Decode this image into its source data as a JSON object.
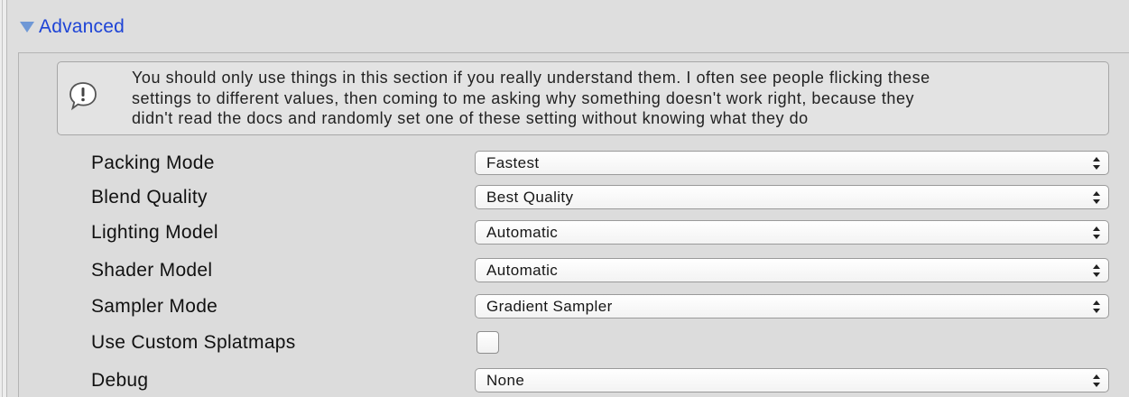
{
  "foldout": {
    "label": "Advanced",
    "expanded": true
  },
  "help_box": {
    "icon": "info-icon",
    "text": "You should only use things in this section if you really understand them. I often see people flicking these\nsettings to different values, then coming to me asking why something doesn't work right, because they\ndidn't read the docs and randomly set one of these setting without knowing what they do"
  },
  "properties": [
    {
      "label": "Packing Mode",
      "type": "dropdown",
      "value": "Fastest"
    },
    {
      "label": "Blend Quality",
      "type": "dropdown",
      "value": "Best Quality"
    },
    {
      "label": "Lighting Model",
      "type": "dropdown",
      "value": "Automatic"
    },
    {
      "label": "Shader Model",
      "type": "dropdown",
      "value": "Automatic"
    },
    {
      "label": "Sampler Mode",
      "type": "dropdown",
      "value": "Gradient Sampler"
    },
    {
      "label": "Use Custom Splatmaps",
      "type": "checkbox",
      "checked": false
    },
    {
      "label": "Debug",
      "type": "dropdown",
      "value": "None"
    }
  ],
  "colors": {
    "foldout_label": "#1e44d6",
    "foldout_arrow": "#6f98d6",
    "panel_background": "#dedede"
  }
}
